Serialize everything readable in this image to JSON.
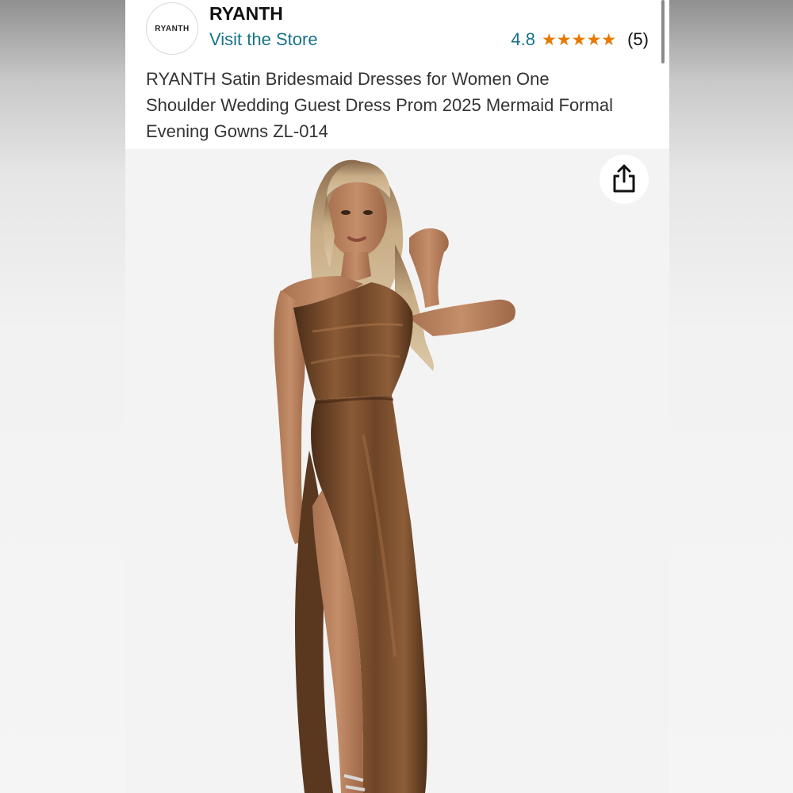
{
  "store": {
    "logo_text": "RYANTH",
    "name": "RYANTH",
    "visit_label": "Visit the Store"
  },
  "rating": {
    "value": "4.8",
    "stars": 5,
    "count": "(5)"
  },
  "product": {
    "title": "RYANTH Satin Bridesmaid Dresses for Women One Shoulder Wedding Guest Dress Prom 2025 Mermaid Formal Evening Gowns ZL-014"
  },
  "icons": {
    "share": "share-icon",
    "star": "star-icon"
  },
  "colors": {
    "link": "#17738a",
    "star": "#e67a00",
    "dress": "#6e4527",
    "image_bg": "#f4f3f3"
  }
}
